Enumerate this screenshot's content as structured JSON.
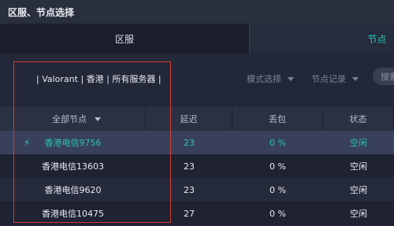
{
  "window": {
    "title": "区服、节点选择"
  },
  "tabs": {
    "region": "区服",
    "node": "节点"
  },
  "game_info": "| Valorant | 香港 | 所有服务器 |",
  "filters": {
    "mode": "模式选择",
    "record": "节点记录"
  },
  "search": {
    "placeholder": "搜索"
  },
  "table": {
    "headers": {
      "node": "全部节点",
      "latency": "延迟",
      "loss": "丢包",
      "status": "状态"
    },
    "rows": [
      {
        "node": "香港电信9756",
        "latency": "23",
        "loss": "0 %",
        "status": "空闲",
        "selected": true
      },
      {
        "node": "香港电信13603",
        "latency": "23",
        "loss": "0 %",
        "status": "空闲",
        "selected": false
      },
      {
        "node": "香港电信9620",
        "latency": "23",
        "loss": "0 %",
        "status": "空闲",
        "selected": false
      },
      {
        "node": "香港电信10475",
        "latency": "27",
        "loss": "0 %",
        "status": "空闲",
        "selected": false
      }
    ]
  },
  "colors": {
    "accent": "#28c4b6",
    "highlight_border": "#d63a32"
  },
  "icons": {
    "selected_row": "lightning-icon",
    "dropdown": "chevron-down-icon"
  }
}
